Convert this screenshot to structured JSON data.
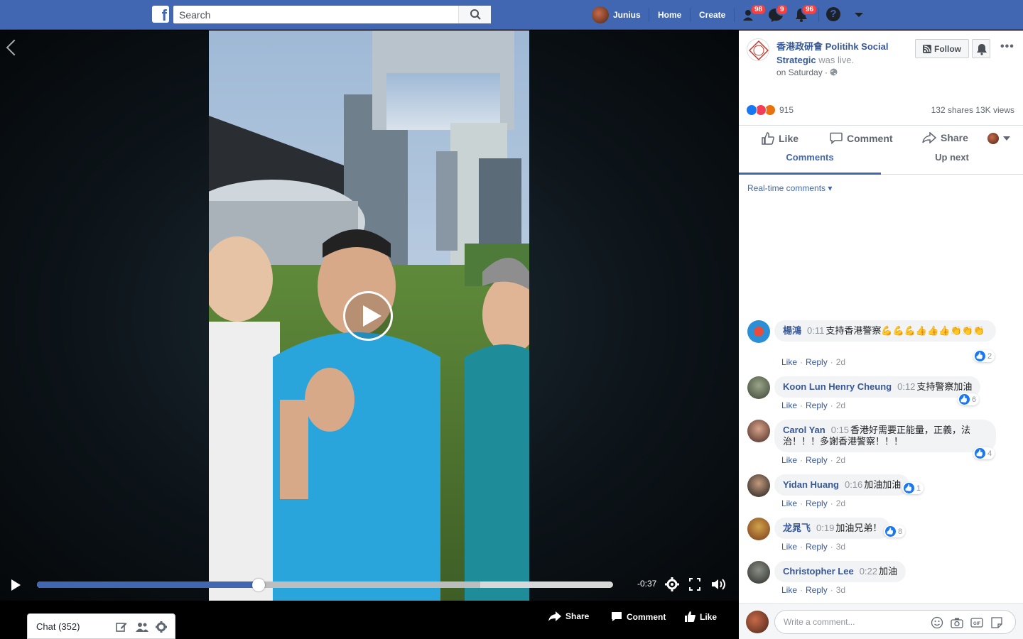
{
  "topbar": {
    "logo": "f",
    "search_placeholder": "Search",
    "user_name": "Junius",
    "home": "Home",
    "create": "Create",
    "friend_requests_badge": "98",
    "messages_badge": "9",
    "notifications_badge": "96",
    "help": "?"
  },
  "player": {
    "time_remaining": "-0:37",
    "progress_fraction": 0.385,
    "buffer_fraction": 0.77
  },
  "bottom_actions": {
    "share": "Share",
    "comment": "Comment",
    "like": "Like"
  },
  "chat": {
    "label": "Chat (352)"
  },
  "post": {
    "page_name": "香港政研會 Politihk Social Strategic",
    "was_live": "was live.",
    "time": "on Saturday ·",
    "follow": "Follow",
    "more": "•••",
    "reaction_count": "915",
    "stats": "132 shares  13K views",
    "like": "Like",
    "comment": "Comment",
    "share": "Share",
    "tab_comments": "Comments",
    "tab_up_next": "Up next",
    "realtime": "Real-time comments ▾"
  },
  "comments": [
    {
      "author": "楊鴻",
      "ts": "0:11",
      "text": "支持香港警察💪💪💪👍👍👍👏👏👏",
      "likes": "2",
      "age": "2d",
      "like": "Like",
      "reply": "Reply"
    },
    {
      "author": "Koon Lun Henry Cheung",
      "ts": "0:12",
      "text": "支持警察加油",
      "likes": "6",
      "age": "2d",
      "like": "Like",
      "reply": "Reply"
    },
    {
      "author": "Carol Yan",
      "ts": "0:15",
      "text": "香港好需要正能量，正義，法治！！！多謝香港警察！！！",
      "likes": "4",
      "age": "2d",
      "like": "Like",
      "reply": "Reply"
    },
    {
      "author": "Yidan Huang",
      "ts": "0:16",
      "text": "加油加油",
      "likes": "1",
      "age": "2d",
      "like": "Like",
      "reply": "Reply"
    },
    {
      "author": "龙晁飞",
      "ts": "0:19",
      "text": "加油兄弟！",
      "likes": "8",
      "age": "3d",
      "like": "Like",
      "reply": "Reply"
    },
    {
      "author": "Christopher Lee",
      "ts": "0:22",
      "text": "加油",
      "likes": "",
      "age": "3d",
      "like": "Like",
      "reply": "Reply"
    }
  ],
  "compose": {
    "placeholder": "Write a comment..."
  },
  "colors": {
    "brand": "#4267b2",
    "link": "#385898",
    "badge": "#fa3e3e"
  }
}
